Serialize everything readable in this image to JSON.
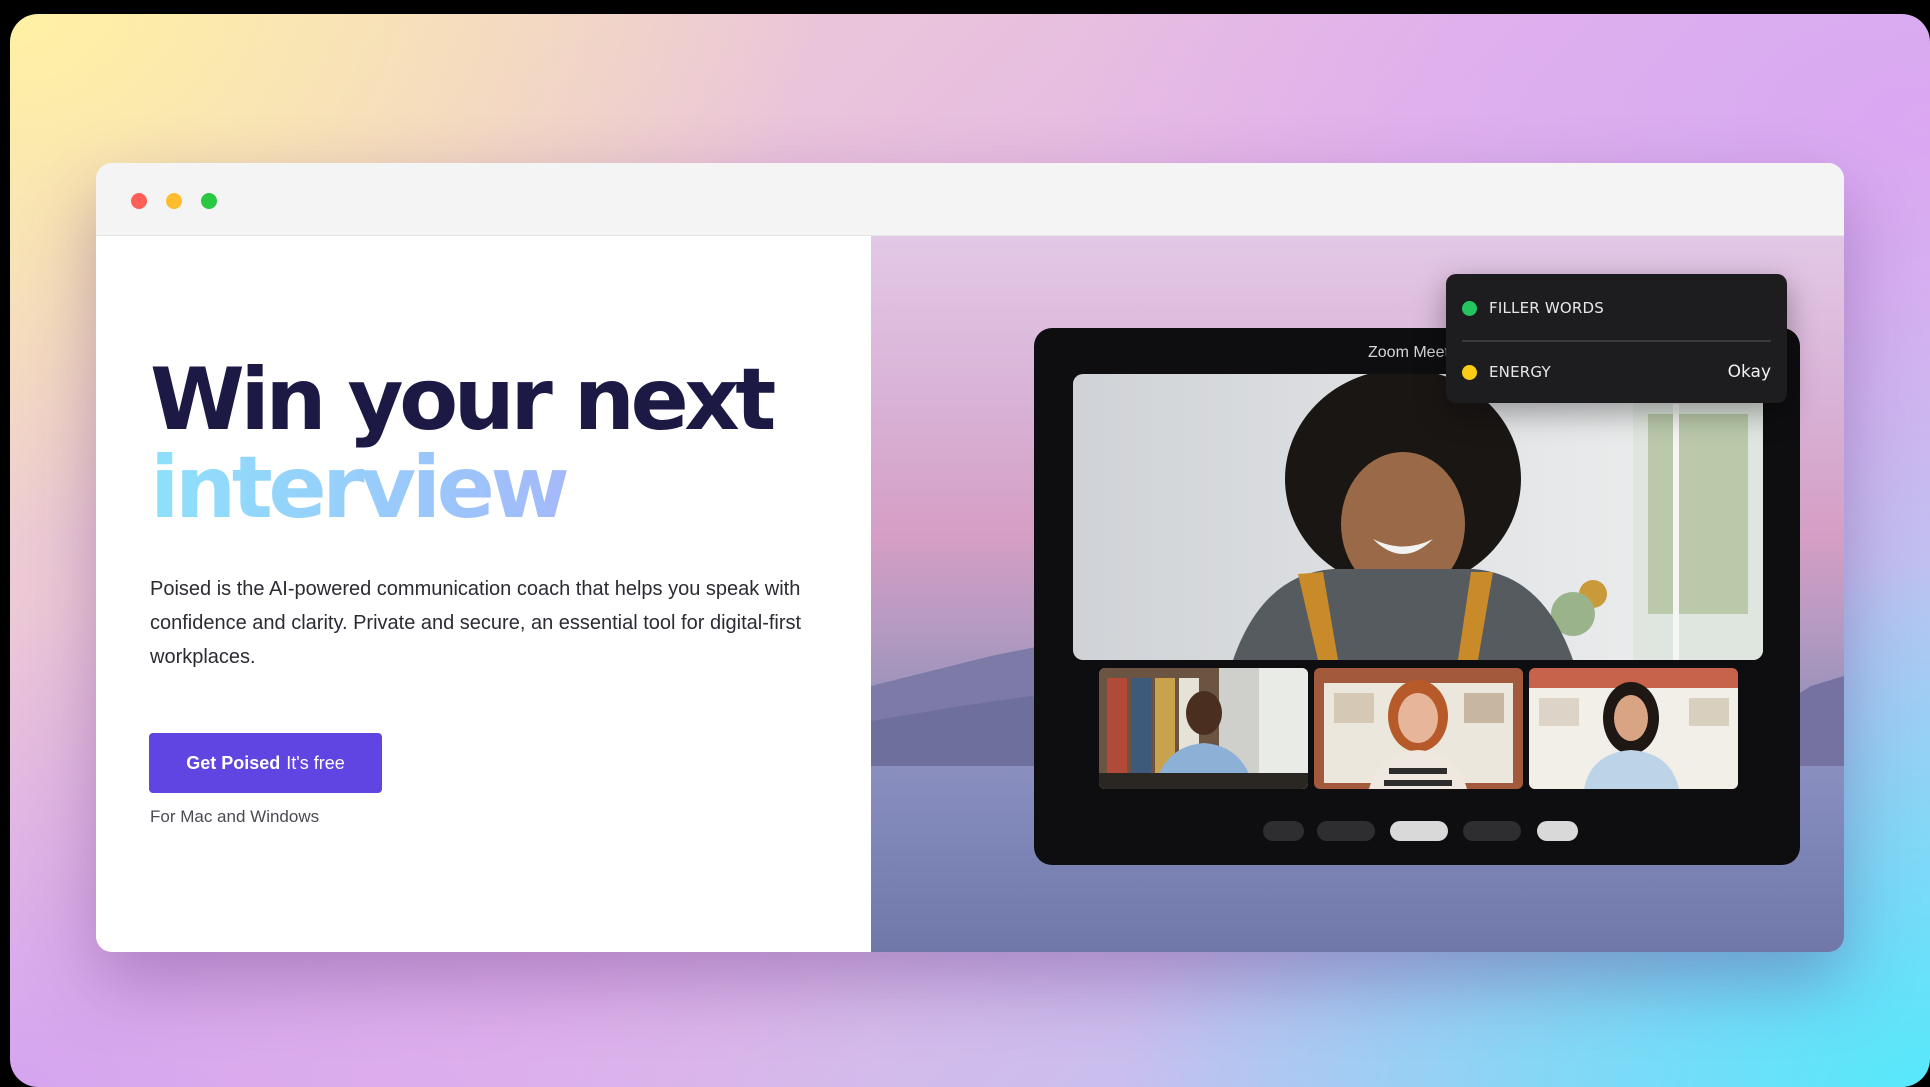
{
  "hero": {
    "headline_line1": "Win your next",
    "headline_line2": "interview",
    "description": "Poised is the AI-powered communication coach that helps you speak with confidence and clarity. Private and secure, an essential tool for digital-first workplaces.",
    "cta_bold": "Get Poised",
    "cta_light": "It's free",
    "platform_note": "For Mac and Windows"
  },
  "zoom": {
    "window_title": "Zoom Meet"
  },
  "metrics": [
    {
      "label": "FILLER WORDS",
      "value": "",
      "status_color": "#22c55e"
    },
    {
      "label": "ENERGY",
      "value": "Okay",
      "status_color": "#facc15"
    }
  ],
  "colors": {
    "accent": "#6045e2",
    "headline": "#1c1a45"
  }
}
